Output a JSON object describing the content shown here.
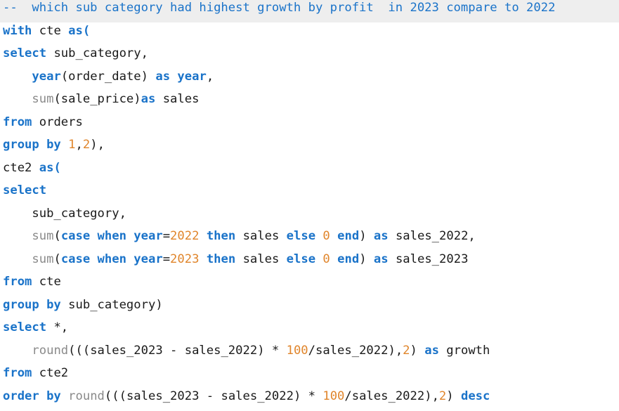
{
  "editor": {
    "background": "#ffffff",
    "colors": {
      "keyword": "#1a73c9",
      "function": "#8a8a8a",
      "number": "#e0852b",
      "comment": "#1a73c9",
      "text": "#1a1a1a",
      "highlight": "#eeeeee"
    },
    "lines": [
      {
        "highlight": true,
        "tokens": [
          [
            "cm",
            "--  which sub category had highest growth by profit  in 2023 compare to 2022"
          ]
        ]
      },
      {
        "tokens": [
          [
            "kw",
            "with"
          ],
          [
            "tx",
            " cte "
          ],
          [
            "kw",
            "as("
          ]
        ]
      },
      {
        "tokens": [
          [
            "kw",
            "select"
          ],
          [
            "tx",
            " sub_category,"
          ]
        ]
      },
      {
        "tokens": [
          [
            "tx",
            "    "
          ],
          [
            "kw",
            "year"
          ],
          [
            "tx",
            "(order_date) "
          ],
          [
            "kw",
            "as"
          ],
          [
            "tx",
            " "
          ],
          [
            "kw",
            "year"
          ],
          [
            "tx",
            ","
          ]
        ]
      },
      {
        "tokens": [
          [
            "tx",
            "    "
          ],
          [
            "fn",
            "sum"
          ],
          [
            "tx",
            "(sale_price)"
          ],
          [
            "kw",
            "as"
          ],
          [
            "tx",
            " sales"
          ]
        ]
      },
      {
        "tokens": [
          [
            "kw",
            "from"
          ],
          [
            "tx",
            " orders"
          ]
        ]
      },
      {
        "tokens": [
          [
            "kw",
            "group by"
          ],
          [
            "tx",
            " "
          ],
          [
            "num",
            "1"
          ],
          [
            "tx",
            ","
          ],
          [
            "num",
            "2"
          ],
          [
            "tx",
            "),"
          ]
        ]
      },
      {
        "tokens": [
          [
            "tx",
            "cte2 "
          ],
          [
            "kw",
            "as("
          ]
        ]
      },
      {
        "tokens": [
          [
            "kw",
            "select"
          ]
        ]
      },
      {
        "tokens": [
          [
            "tx",
            "    sub_category,"
          ]
        ]
      },
      {
        "tokens": [
          [
            "tx",
            "    "
          ],
          [
            "fn",
            "sum"
          ],
          [
            "tx",
            "("
          ],
          [
            "kw",
            "case when year"
          ],
          [
            "tx",
            "="
          ],
          [
            "num",
            "2022"
          ],
          [
            "tx",
            " "
          ],
          [
            "kw",
            "then"
          ],
          [
            "tx",
            " sales "
          ],
          [
            "kw",
            "else"
          ],
          [
            "tx",
            " "
          ],
          [
            "num",
            "0"
          ],
          [
            "tx",
            " "
          ],
          [
            "kw",
            "end"
          ],
          [
            "tx",
            ") "
          ],
          [
            "kw",
            "as"
          ],
          [
            "tx",
            " sales_2022,"
          ]
        ]
      },
      {
        "tokens": [
          [
            "tx",
            "    "
          ],
          [
            "fn",
            "sum"
          ],
          [
            "tx",
            "("
          ],
          [
            "kw",
            "case when year"
          ],
          [
            "tx",
            "="
          ],
          [
            "num",
            "2023"
          ],
          [
            "tx",
            " "
          ],
          [
            "kw",
            "then"
          ],
          [
            "tx",
            " sales "
          ],
          [
            "kw",
            "else"
          ],
          [
            "tx",
            " "
          ],
          [
            "num",
            "0"
          ],
          [
            "tx",
            " "
          ],
          [
            "kw",
            "end"
          ],
          [
            "tx",
            ") "
          ],
          [
            "kw",
            "as"
          ],
          [
            "tx",
            " sales_2023"
          ]
        ]
      },
      {
        "tokens": [
          [
            "kw",
            "from"
          ],
          [
            "tx",
            " cte"
          ]
        ]
      },
      {
        "tokens": [
          [
            "kw",
            "group by"
          ],
          [
            "tx",
            " sub_category)"
          ]
        ]
      },
      {
        "tokens": [
          [
            "kw",
            "select"
          ],
          [
            "tx",
            " *,"
          ]
        ]
      },
      {
        "tokens": [
          [
            "tx",
            "    "
          ],
          [
            "fn",
            "round"
          ],
          [
            "tx",
            "(((sales_2023 - sales_2022) * "
          ],
          [
            "num",
            "100"
          ],
          [
            "tx",
            "/sales_2022),"
          ],
          [
            "num",
            "2"
          ],
          [
            "tx",
            ") "
          ],
          [
            "kw",
            "as"
          ],
          [
            "tx",
            " growth"
          ]
        ]
      },
      {
        "tokens": [
          [
            "kw",
            "from"
          ],
          [
            "tx",
            " cte2"
          ]
        ]
      },
      {
        "tokens": [
          [
            "kw",
            "order by"
          ],
          [
            "tx",
            " "
          ],
          [
            "fn",
            "round"
          ],
          [
            "tx",
            "(((sales_2023 - sales_2022) * "
          ],
          [
            "num",
            "100"
          ],
          [
            "tx",
            "/sales_2022),"
          ],
          [
            "num",
            "2"
          ],
          [
            "tx",
            ") "
          ],
          [
            "kw",
            "desc"
          ]
        ]
      }
    ]
  }
}
